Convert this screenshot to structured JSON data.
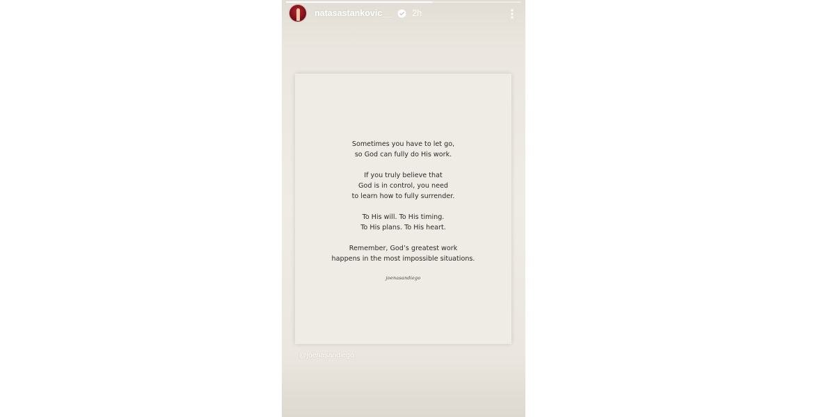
{
  "story": {
    "progress": 0.62,
    "header": {
      "username": "natasastankovic__",
      "time": "2h",
      "avatar_icon": "avatar-photo",
      "verified_icon": "verified-badge-icon",
      "menu_icon": "more-vertical-icon"
    },
    "card": {
      "paragraphs": [
        "Sometimes you have to let go,\nso God can fully do His work.",
        "If you truly believe that\nGod is in control, you need\nto learn how to fully surrender.",
        "To His will. To His timing.\nTo His plans. To His heart.",
        "Remember, God’s greatest work\nhappens in the most impossible situations."
      ],
      "signature": "joenasandiego"
    },
    "mention": "@joenasandiego"
  },
  "colors": {
    "background": "#efebe5",
    "text": "#2a2a2a",
    "avatar": "#7e0f19"
  }
}
